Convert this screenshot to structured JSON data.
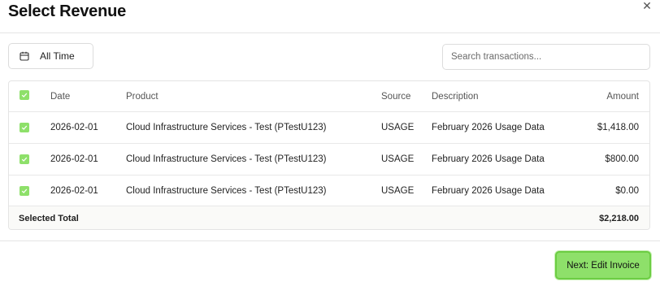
{
  "dialog": {
    "title": "Select Revenue",
    "close_icon": "close-icon"
  },
  "toolbar": {
    "date_filter_icon": "calendar-icon",
    "date_filter_label": "All Time",
    "search_placeholder": "Search transactions...",
    "search_value": ""
  },
  "table": {
    "header_checked": true,
    "columns": [
      "Date",
      "Product",
      "Source",
      "Description",
      "Amount"
    ],
    "rows": [
      {
        "checked": true,
        "date": "2026-02-01",
        "product": "Cloud Infrastructure Services - Test (PTestU123)",
        "source": "USAGE",
        "description": "February 2026 Usage Data",
        "amount": "$1,418.00"
      },
      {
        "checked": true,
        "date": "2026-02-01",
        "product": "Cloud Infrastructure Services - Test (PTestU123)",
        "source": "USAGE",
        "description": "February 2026 Usage Data",
        "amount": "$800.00"
      },
      {
        "checked": true,
        "date": "2026-02-01",
        "product": "Cloud Infrastructure Services - Test (PTestU123)",
        "source": "USAGE",
        "description": "February 2026 Usage Data",
        "amount": "$0.00"
      }
    ],
    "total_label": "Selected Total",
    "total_value": "$2,218.00"
  },
  "footer": {
    "next_label": "Next: Edit Invoice"
  },
  "colors": {
    "accent": "#8ee06a",
    "accent_border": "#6ccd43"
  }
}
